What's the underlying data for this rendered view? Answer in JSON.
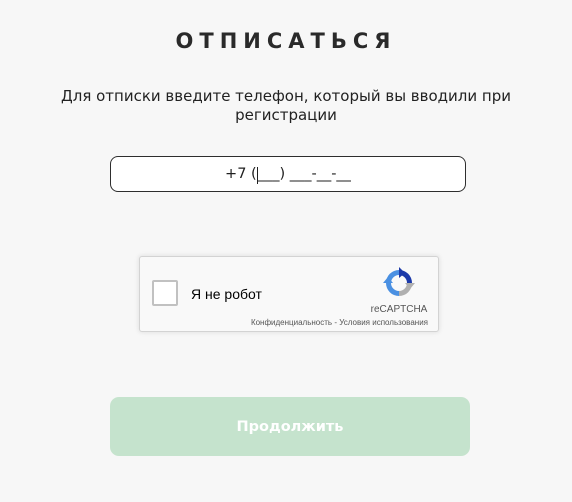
{
  "page": {
    "title": "ОТПИСАТЬСЯ",
    "subtitle": "Для отписки введите телефон, который вы вводили при регистрации"
  },
  "phone_input": {
    "prefix": "+7 (",
    "mask_rest": "___) ___-__-__"
  },
  "recaptcha": {
    "label": "Я не робот",
    "brand": "reCAPTCHA",
    "privacy_link": "Конфиденциальность",
    "separator": " - ",
    "terms_link": "Условия использования",
    "logo_icon": "recaptcha-logo-icon"
  },
  "continue_button": {
    "label": "Продолжить"
  },
  "colors": {
    "background": "#f7f7f7",
    "button_disabled": "#c5e3cd",
    "recaptcha_blue": "#4a90e2",
    "recaptcha_darkblue": "#1c3aa9",
    "recaptcha_gray": "#b0b0b0"
  }
}
